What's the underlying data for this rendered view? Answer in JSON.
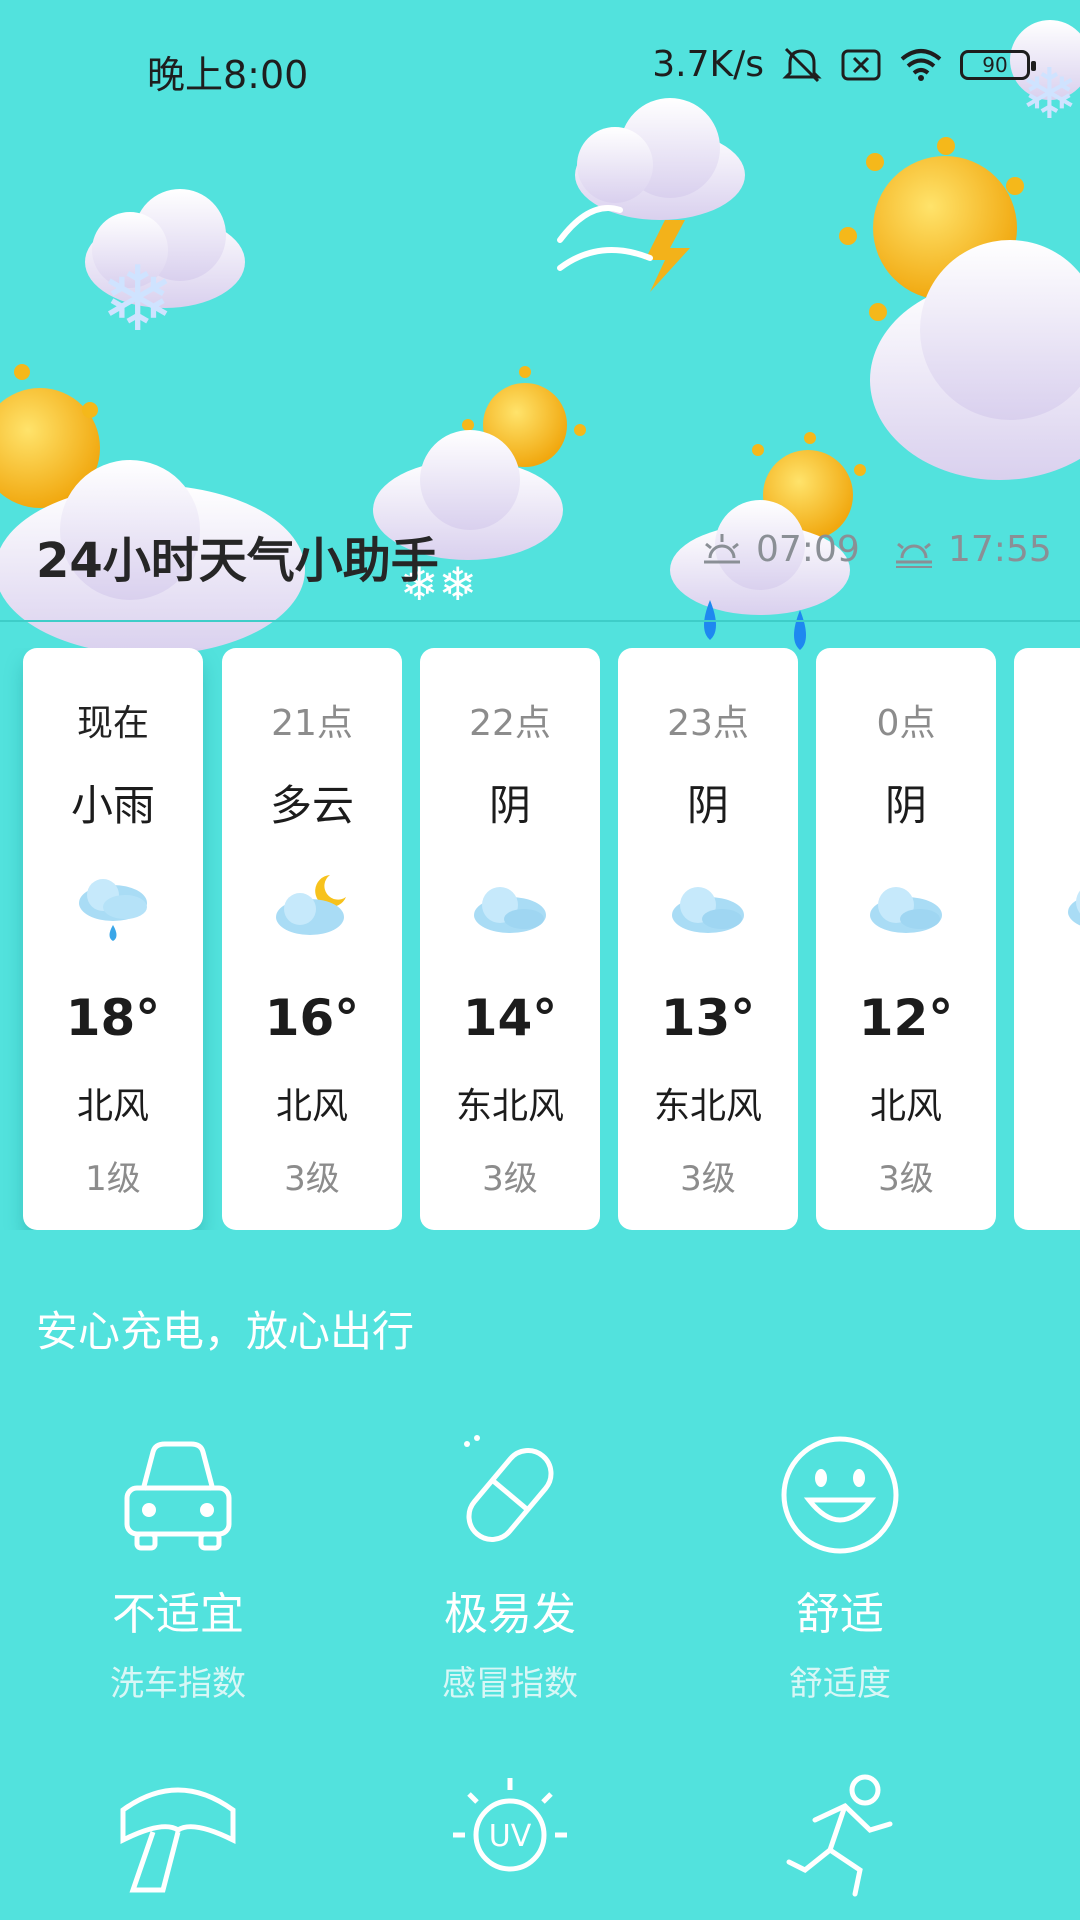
{
  "status_bar": {
    "time": "晚上8:00",
    "net_speed": "3.7K/s",
    "battery": "90",
    "icons": [
      "mute-icon",
      "sim-x-icon",
      "wifi-icon",
      "battery-icon"
    ]
  },
  "header": {
    "title": "24小时天气小助手",
    "sunrise": "07:09",
    "sunset": "17:55"
  },
  "hourly": [
    {
      "time": "现在",
      "condition": "小雨",
      "icon": "light-rain-icon",
      "temp": "18°",
      "wind": "北风",
      "level": "1级"
    },
    {
      "time": "21点",
      "condition": "多云",
      "icon": "partly-cloudy-night-icon",
      "temp": "16°",
      "wind": "北风",
      "level": "3级"
    },
    {
      "time": "22点",
      "condition": "阴",
      "icon": "overcast-icon",
      "temp": "14°",
      "wind": "东北风",
      "level": "3级"
    },
    {
      "time": "23点",
      "condition": "阴",
      "icon": "overcast-icon",
      "temp": "13°",
      "wind": "东北风",
      "level": "3级"
    },
    {
      "time": "0点",
      "condition": "阴",
      "icon": "overcast-icon",
      "temp": "12°",
      "wind": "北风",
      "level": "3级"
    }
  ],
  "life_index": {
    "title": "安心充电，放心出行",
    "items": [
      {
        "icon": "car-icon",
        "value": "不适宜",
        "name": "洗车指数"
      },
      {
        "icon": "pill-icon",
        "value": "极易发",
        "name": "感冒指数"
      },
      {
        "icon": "smile-icon",
        "value": "舒适",
        "name": "舒适度"
      },
      {
        "icon": "scarf-icon"
      },
      {
        "icon": "uv-icon"
      },
      {
        "icon": "running-icon"
      }
    ]
  },
  "colors": {
    "background": "#52e2dd",
    "card": "#ffffff",
    "sun": "#f7c21c",
    "rain_drop": "#1e88f0"
  }
}
